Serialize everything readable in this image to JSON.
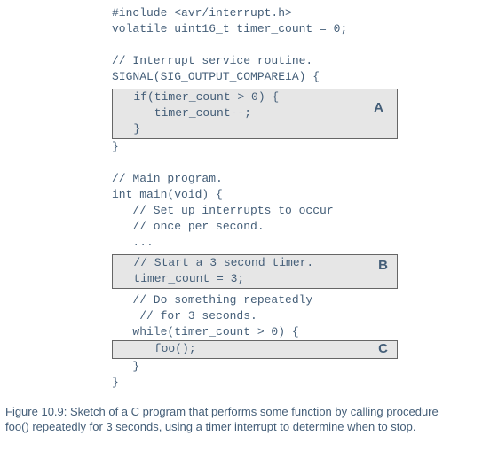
{
  "code": {
    "l1": "#include <avr/interrupt.h>",
    "l2": "volatile uint16_t timer_count = 0;",
    "l3": "// Interrupt service routine.",
    "l4": "SIGNAL(SIG_OUTPUT_COMPARE1A) {",
    "boxA_line1": "   if(timer_count > 0) {",
    "boxA_line2": "      timer_count--;",
    "boxA_line3": "   }",
    "l5": "}",
    "l6": "// Main program.",
    "l7": "int main(void) {",
    "l8": "   // Set up interrupts to occur",
    "l9": "   // once per second.",
    "l10": "   ...",
    "boxB_line1": "   // Start a 3 second timer.",
    "boxB_line2": "   timer_count = 3;",
    "l11": "   // Do something repeatedly",
    "l12": "    // for 3 seconds.",
    "l13": "   while(timer_count > 0) {",
    "boxC_line1": "      foo();",
    "l14": "   }",
    "l15": "}"
  },
  "labels": {
    "a": "A",
    "b": "B",
    "c": "C"
  },
  "caption": "Figure 10.9: Sketch of a C program that performs some function by calling procedure foo() repeatedly for 3 seconds, using a timer interrupt to determine when to stop."
}
